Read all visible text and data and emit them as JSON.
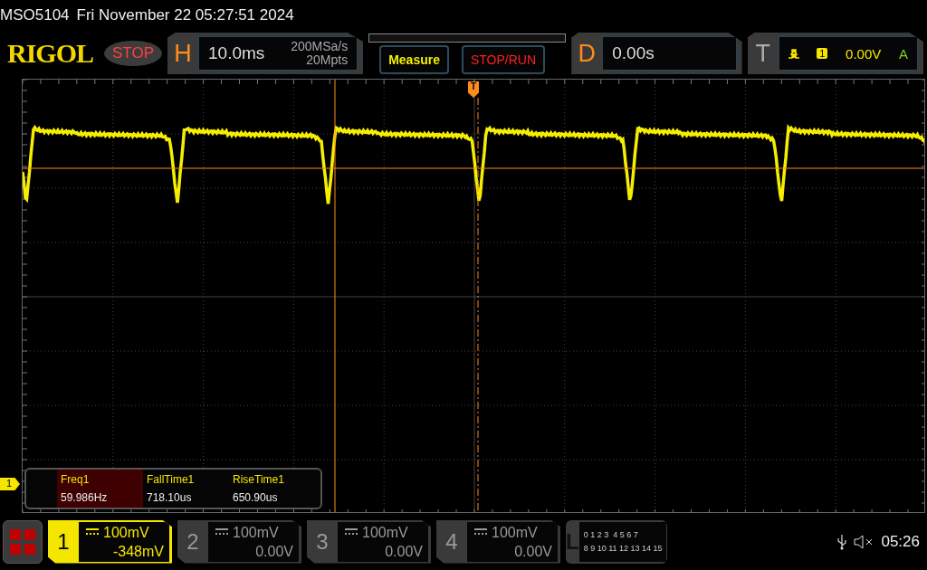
{
  "header": {
    "model": "MSO5104",
    "datetime": "Fri November 22 05:27:51 2024"
  },
  "logo": "RIGOL",
  "run_state": "STOP",
  "horizontal": {
    "label": "H",
    "timebase": "10.0ms",
    "sample_rate": "200MSa/s",
    "memory_depth": "20Mpts"
  },
  "buttons": [
    {
      "kind": "measure",
      "label": "Measure"
    },
    {
      "kind": "stoprun",
      "label": "STOP/RUN"
    }
  ],
  "delay": {
    "label": "D",
    "value": "0.00s"
  },
  "trigger": {
    "label": "T",
    "source": "1",
    "level": "0.00V",
    "mode": "A"
  },
  "trigger_marker": "T",
  "channel_marker": "1",
  "measurements": [
    {
      "name": "Freq1",
      "value": "59.986Hz",
      "selected": true
    },
    {
      "name": "FallTime1",
      "value": "718.10us",
      "selected": false
    },
    {
      "name": "RiseTime1",
      "value": "650.90us",
      "selected": false
    }
  ],
  "channels": [
    {
      "number": "1",
      "scale": "100mV",
      "offset": "-348mV",
      "selected": true
    },
    {
      "number": "2",
      "scale": "100mV",
      "offset": "0.00V",
      "selected": false
    },
    {
      "number": "3",
      "scale": "100mV",
      "offset": "0.00V",
      "selected": false
    },
    {
      "number": "4",
      "scale": "100mV",
      "offset": "0.00V",
      "selected": false
    }
  ],
  "logic": {
    "label": "L",
    "row_1": "0 1 2 3  4 5 6 7",
    "row_2": "8 9 10 11 12 13 14 15"
  },
  "status": {
    "time": "05:26"
  }
}
